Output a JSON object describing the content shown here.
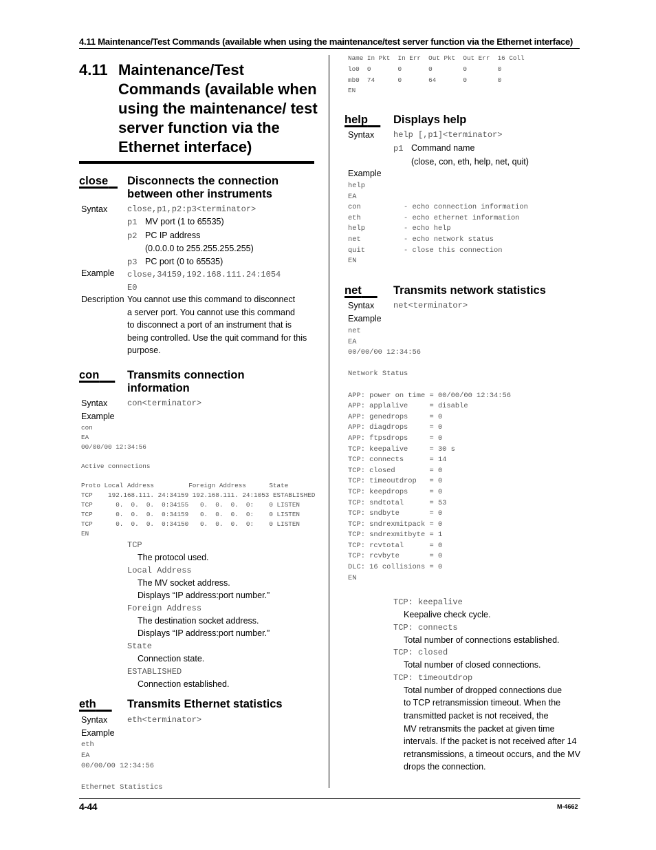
{
  "running_header": "4.11  Maintenance/Test Commands (available when using the maintenance/test server function via the Ethernet interface)",
  "section": {
    "number": "4.11",
    "title": "Maintenance/Test Commands (available when using the maintenance/ test server function via the Ethernet interface)"
  },
  "labels": {
    "syntax": "Syntax",
    "example": "Example",
    "description": "Description"
  },
  "close": {
    "name": "close",
    "title_line1": "Disconnects the connection",
    "title_line2": "between other instruments",
    "syntax": "close,p1,p2:p3<terminator>",
    "params": [
      {
        "key": "p1",
        "text": "MV port (1 to 65535)"
      },
      {
        "key": "p2",
        "text": "PC IP address",
        "text2": "(0.0.0.0 to 255.255.255.255)"
      },
      {
        "key": "p3",
        "text": "PC port (0 to 65535)"
      }
    ],
    "example_lines": [
      "close,34159,192.168.111.24:1054",
      "E0"
    ],
    "description_lines": [
      "You cannot use this command to disconnect",
      "a server port. You cannot use this command",
      "to disconnect a port of an instrument that is",
      "being controlled. Use the quit command for this",
      "purpose."
    ]
  },
  "con": {
    "name": "con",
    "title_line1": "Transmits connection",
    "title_line2": "information",
    "syntax": "con<terminator>",
    "example_lines": [
      "con",
      "EA",
      "00/00/00 12:34:56",
      "",
      "Active connections",
      "",
      "Proto Local Address         Foreign Address      State",
      "TCP    192.168.111. 24:34159 192.168.111. 24:1053 ESTABLISHED",
      "TCP      0.  0.  0.  0:34155   0.  0.  0.  0:    0 LISTEN",
      "TCP      0.  0.  0.  0:34159   0.  0.  0.  0:    0 LISTEN",
      "TCP      0.  0.  0.  0:34150   0.  0.  0.  0:    0 LISTEN",
      "EN"
    ],
    "fields": [
      {
        "term": "TCP",
        "desc": [
          "The protocol used."
        ]
      },
      {
        "term": "Local Address",
        "desc": [
          "The MV socket address.",
          "Displays “IP address:port number.”"
        ]
      },
      {
        "term": "Foreign Address",
        "desc": [
          "The destination socket address.",
          "Displays “IP address:port number.”"
        ]
      },
      {
        "term": "State",
        "desc": [
          "Connection state."
        ]
      },
      {
        "term": "ESTABLISHED",
        "desc": [
          "Connection established."
        ]
      }
    ]
  },
  "eth": {
    "name": "eth",
    "title": "Transmits Ethernet statistics",
    "syntax": "eth<terminator>",
    "example_lines": [
      "eth",
      "EA",
      "00/00/00 12:34:56",
      "",
      "Ethernet Statistics"
    ],
    "table": {
      "headers": [
        "Name",
        "In Pkt",
        "In Err",
        "Out Pkt",
        "Out Err",
        "16 Coll"
      ],
      "rows": [
        [
          "lo0",
          "0",
          "0",
          "0",
          "0",
          "0"
        ],
        [
          "mb0",
          "74",
          "0",
          "64",
          "0",
          "0"
        ]
      ],
      "end": "EN"
    }
  },
  "help": {
    "name": "help",
    "title": "Displays help",
    "syntax": "help [,p1]<terminator>",
    "param_key": "p1",
    "param_text": "Command name",
    "param_text2": "(close, con, eth, help, net, quit)",
    "example_lines": [
      "help",
      "EA",
      "con          - echo connection information",
      "eth          - echo ethernet information",
      "help         - echo help",
      "net          - echo network status",
      "quit         - close this connection",
      "EN"
    ]
  },
  "net": {
    "name": "net",
    "title": "Transmits network statistics",
    "syntax": "net<terminator>",
    "example_lines": [
      "net",
      "EA",
      "00/00/00 12:34:56",
      "",
      "Network Status",
      "",
      "APP: power on time = 00/00/00 12:34:56",
      "APP: applalive     = disable",
      "APP: genedrops     = 0",
      "APP: diagdrops     = 0",
      "APP: ftpsdrops     = 0",
      "TCP: keepalive     = 30 s",
      "TCP: connects      = 14",
      "TCP: closed        = 0",
      "TCP: timeoutdrop   = 0",
      "TCP: keepdrops     = 0",
      "TCP: sndtotal      = 53",
      "TCP: sndbyte       = 0",
      "TCP: sndrexmitpack = 0",
      "TCP: sndrexmitbyte = 1",
      "TCP: rcvtotal      = 0",
      "TCP: rcvbyte       = 0",
      "DLC: 16 collisions = 0",
      "EN"
    ],
    "fields": [
      {
        "term": "TCP: keepalive",
        "desc": [
          "Keepalive check cycle."
        ]
      },
      {
        "term": "TCP: connects",
        "desc": [
          "Total number of connections established."
        ]
      },
      {
        "term": "TCP: closed",
        "desc": [
          "Total number of closed connections."
        ]
      },
      {
        "term": "TCP: timeoutdrop",
        "desc": [
          "Total number of dropped connections due",
          "to TCP retransmission timeout. When the",
          "transmitted packet is not received, the",
          "MV retransmits the packet at given time",
          "intervals. If the packet is not received after 14",
          "retransmissions, a timeout occurs, and the MV",
          "drops the connection."
        ]
      }
    ]
  },
  "footer": {
    "page_number": "4-44",
    "doc_code": "M-4662"
  }
}
